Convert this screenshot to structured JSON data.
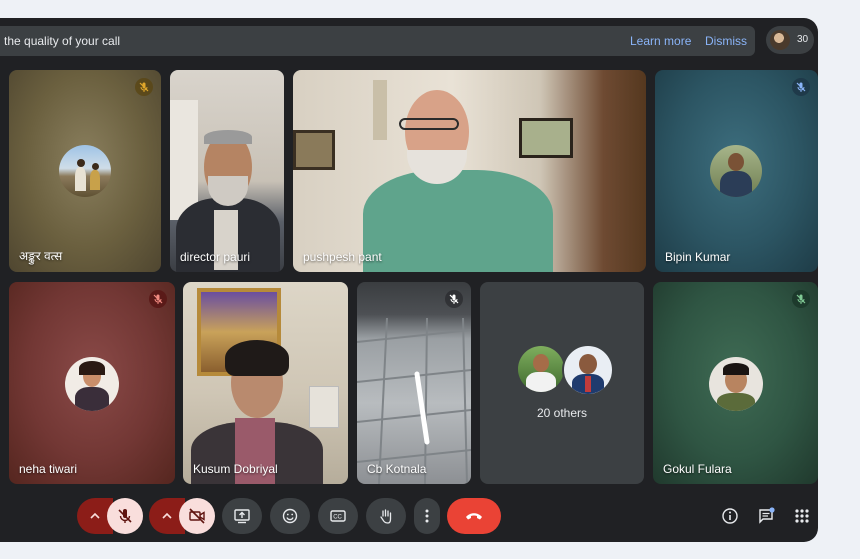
{
  "banner": {
    "message": "the quality of your call",
    "learn_more": "Learn more",
    "dismiss": "Dismiss"
  },
  "people": {
    "count": "30"
  },
  "tiles": [
    {
      "name": "अङ्कुर वत्स",
      "muted": true
    },
    {
      "name": "director pauri",
      "muted": false
    },
    {
      "name": "pushpesh pant",
      "muted": false
    },
    {
      "name": "Bipin Kumar",
      "muted": true
    },
    {
      "name": "neha tiwari",
      "muted": true
    },
    {
      "name": "Kusum Dobriyal",
      "muted": false
    },
    {
      "name": "Cb Kotnala",
      "muted": true
    },
    {
      "name": "20 others",
      "muted": false
    },
    {
      "name": "Gokul Fulara",
      "muted": true
    }
  ],
  "colors": {
    "background": "#202124",
    "tile_dark": "#3c4043",
    "link": "#8ab4f8",
    "end_call": "#ea4335",
    "muted_red": "#8c1d18",
    "muted_pink": "#f9dedc"
  },
  "toolbar": {
    "icons": [
      "chevron-up-icon",
      "mic-off-icon",
      "chevron-up-icon",
      "camera-off-icon",
      "present-screen-icon",
      "emoji-icon",
      "captions-icon",
      "raise-hand-icon",
      "more-options-icon",
      "end-call-icon",
      "info-icon",
      "chat-icon",
      "activities-grid-icon"
    ]
  }
}
